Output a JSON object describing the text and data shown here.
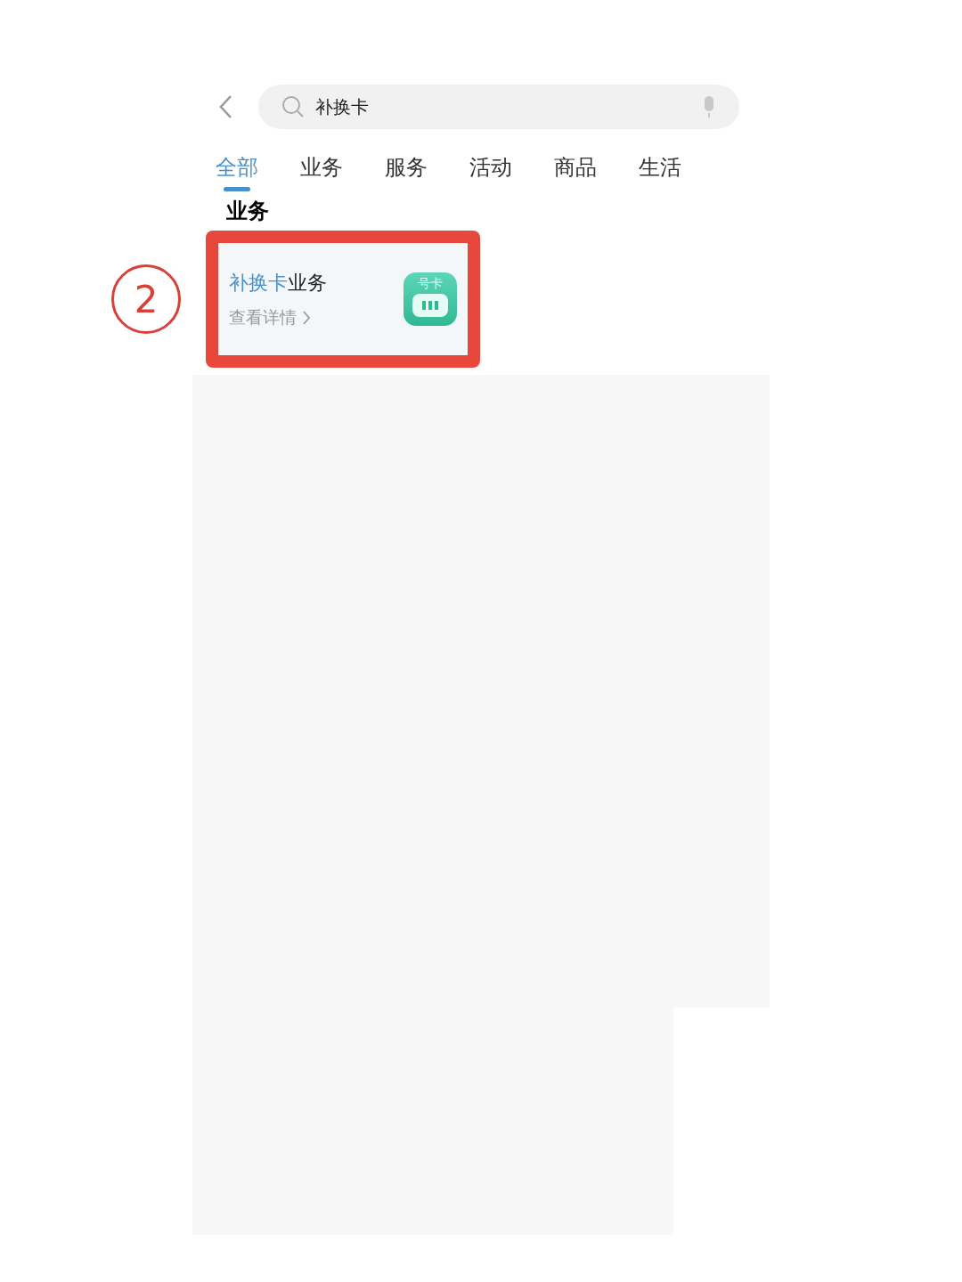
{
  "search": {
    "value": "补换卡"
  },
  "tabs": [
    {
      "label": "全部",
      "selected": true
    },
    {
      "label": "业务",
      "selected": false
    },
    {
      "label": "服务",
      "selected": false
    },
    {
      "label": "活动",
      "selected": false
    },
    {
      "label": "商品",
      "selected": false
    },
    {
      "label": "生活",
      "selected": false
    }
  ],
  "section": {
    "heading": "业务",
    "results": [
      {
        "title_match": "补换卡",
        "title_rest": "业务",
        "link": "查看详情",
        "icon_label": "号卡"
      }
    ]
  },
  "annotation": {
    "step": "2"
  }
}
